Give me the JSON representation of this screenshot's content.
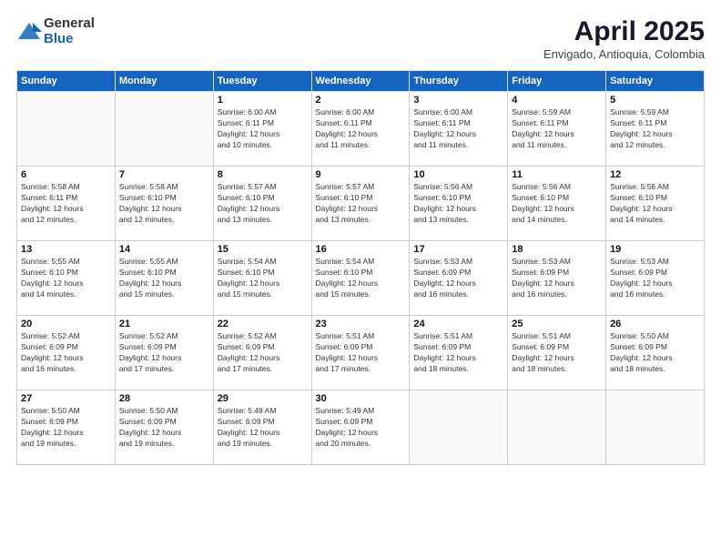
{
  "logo": {
    "general": "General",
    "blue": "Blue"
  },
  "title": "April 2025",
  "subtitle": "Envigado, Antioquia, Colombia",
  "days_of_week": [
    "Sunday",
    "Monday",
    "Tuesday",
    "Wednesday",
    "Thursday",
    "Friday",
    "Saturday"
  ],
  "weeks": [
    [
      {
        "day": "",
        "info": ""
      },
      {
        "day": "",
        "info": ""
      },
      {
        "day": "1",
        "info": "Sunrise: 6:00 AM\nSunset: 6:11 PM\nDaylight: 12 hours\nand 10 minutes."
      },
      {
        "day": "2",
        "info": "Sunrise: 6:00 AM\nSunset: 6:11 PM\nDaylight: 12 hours\nand 11 minutes."
      },
      {
        "day": "3",
        "info": "Sunrise: 6:00 AM\nSunset: 6:11 PM\nDaylight: 12 hours\nand 11 minutes."
      },
      {
        "day": "4",
        "info": "Sunrise: 5:59 AM\nSunset: 6:11 PM\nDaylight: 12 hours\nand 11 minutes."
      },
      {
        "day": "5",
        "info": "Sunrise: 5:59 AM\nSunset: 6:11 PM\nDaylight: 12 hours\nand 12 minutes."
      }
    ],
    [
      {
        "day": "6",
        "info": "Sunrise: 5:58 AM\nSunset: 6:11 PM\nDaylight: 12 hours\nand 12 minutes."
      },
      {
        "day": "7",
        "info": "Sunrise: 5:58 AM\nSunset: 6:10 PM\nDaylight: 12 hours\nand 12 minutes."
      },
      {
        "day": "8",
        "info": "Sunrise: 5:57 AM\nSunset: 6:10 PM\nDaylight: 12 hours\nand 13 minutes."
      },
      {
        "day": "9",
        "info": "Sunrise: 5:57 AM\nSunset: 6:10 PM\nDaylight: 12 hours\nand 13 minutes."
      },
      {
        "day": "10",
        "info": "Sunrise: 5:56 AM\nSunset: 6:10 PM\nDaylight: 12 hours\nand 13 minutes."
      },
      {
        "day": "11",
        "info": "Sunrise: 5:56 AM\nSunset: 6:10 PM\nDaylight: 12 hours\nand 14 minutes."
      },
      {
        "day": "12",
        "info": "Sunrise: 5:56 AM\nSunset: 6:10 PM\nDaylight: 12 hours\nand 14 minutes."
      }
    ],
    [
      {
        "day": "13",
        "info": "Sunrise: 5:55 AM\nSunset: 6:10 PM\nDaylight: 12 hours\nand 14 minutes."
      },
      {
        "day": "14",
        "info": "Sunrise: 5:55 AM\nSunset: 6:10 PM\nDaylight: 12 hours\nand 15 minutes."
      },
      {
        "day": "15",
        "info": "Sunrise: 5:54 AM\nSunset: 6:10 PM\nDaylight: 12 hours\nand 15 minutes."
      },
      {
        "day": "16",
        "info": "Sunrise: 5:54 AM\nSunset: 6:10 PM\nDaylight: 12 hours\nand 15 minutes."
      },
      {
        "day": "17",
        "info": "Sunrise: 5:53 AM\nSunset: 6:09 PM\nDaylight: 12 hours\nand 16 minutes."
      },
      {
        "day": "18",
        "info": "Sunrise: 5:53 AM\nSunset: 6:09 PM\nDaylight: 12 hours\nand 16 minutes."
      },
      {
        "day": "19",
        "info": "Sunrise: 5:53 AM\nSunset: 6:09 PM\nDaylight: 12 hours\nand 16 minutes."
      }
    ],
    [
      {
        "day": "20",
        "info": "Sunrise: 5:52 AM\nSunset: 6:09 PM\nDaylight: 12 hours\nand 16 minutes."
      },
      {
        "day": "21",
        "info": "Sunrise: 5:52 AM\nSunset: 6:09 PM\nDaylight: 12 hours\nand 17 minutes."
      },
      {
        "day": "22",
        "info": "Sunrise: 5:52 AM\nSunset: 6:09 PM\nDaylight: 12 hours\nand 17 minutes."
      },
      {
        "day": "23",
        "info": "Sunrise: 5:51 AM\nSunset: 6:09 PM\nDaylight: 12 hours\nand 17 minutes."
      },
      {
        "day": "24",
        "info": "Sunrise: 5:51 AM\nSunset: 6:09 PM\nDaylight: 12 hours\nand 18 minutes."
      },
      {
        "day": "25",
        "info": "Sunrise: 5:51 AM\nSunset: 6:09 PM\nDaylight: 12 hours\nand 18 minutes."
      },
      {
        "day": "26",
        "info": "Sunrise: 5:50 AM\nSunset: 6:09 PM\nDaylight: 12 hours\nand 18 minutes."
      }
    ],
    [
      {
        "day": "27",
        "info": "Sunrise: 5:50 AM\nSunset: 6:09 PM\nDaylight: 12 hours\nand 19 minutes."
      },
      {
        "day": "28",
        "info": "Sunrise: 5:50 AM\nSunset: 6:09 PM\nDaylight: 12 hours\nand 19 minutes."
      },
      {
        "day": "29",
        "info": "Sunrise: 5:49 AM\nSunset: 6:09 PM\nDaylight: 12 hours\nand 19 minutes."
      },
      {
        "day": "30",
        "info": "Sunrise: 5:49 AM\nSunset: 6:09 PM\nDaylight: 12 hours\nand 20 minutes."
      },
      {
        "day": "",
        "info": ""
      },
      {
        "day": "",
        "info": ""
      },
      {
        "day": "",
        "info": ""
      }
    ]
  ]
}
